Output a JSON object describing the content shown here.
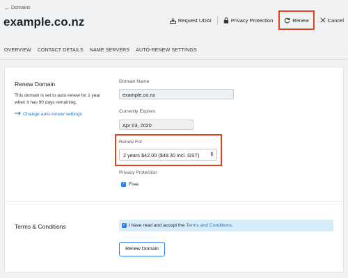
{
  "breadcrumb": {
    "arrow": "←",
    "label": "Domains"
  },
  "title": "example.co.nz",
  "toolbar": {
    "request_udai": "Request UDAI",
    "privacy": "Privacy Protection",
    "renew": "Renew",
    "cancel": "Cancel"
  },
  "tabs": [
    "OVERVIEW",
    "CONTACT DETAILS",
    "NAME SERVERS",
    "AUTO-RENEW SETTINGS"
  ],
  "renew_section": {
    "title": "Renew Domain",
    "description": "This domain is set to auto-renew for 1 year when it has 90 days remaining.",
    "change_link": "Change auto-renew settings"
  },
  "form": {
    "domain_name_label": "Domain Name",
    "domain_name_value": "example.co.nz",
    "expires_label": "Currently Expires",
    "expires_value": "Apr 03, 2020",
    "renew_for_label": "Renew For",
    "renew_for_value": "2 years $42.00 ($48.30 incl. GST)",
    "privacy_label": "Privacy Protection",
    "privacy_option": "Free",
    "privacy_checked": true
  },
  "terms": {
    "title": "Terms & Conditions",
    "text": "I have read and accept the",
    "link": "Terms and Conditions",
    "suffix": ".",
    "checked": true
  },
  "renew_button": "Renew Domain",
  "colors": {
    "accent": "#2d7ee6",
    "link": "#1976c9",
    "highlight": "#e0431f",
    "terms_bg": "#d8ecfa"
  }
}
